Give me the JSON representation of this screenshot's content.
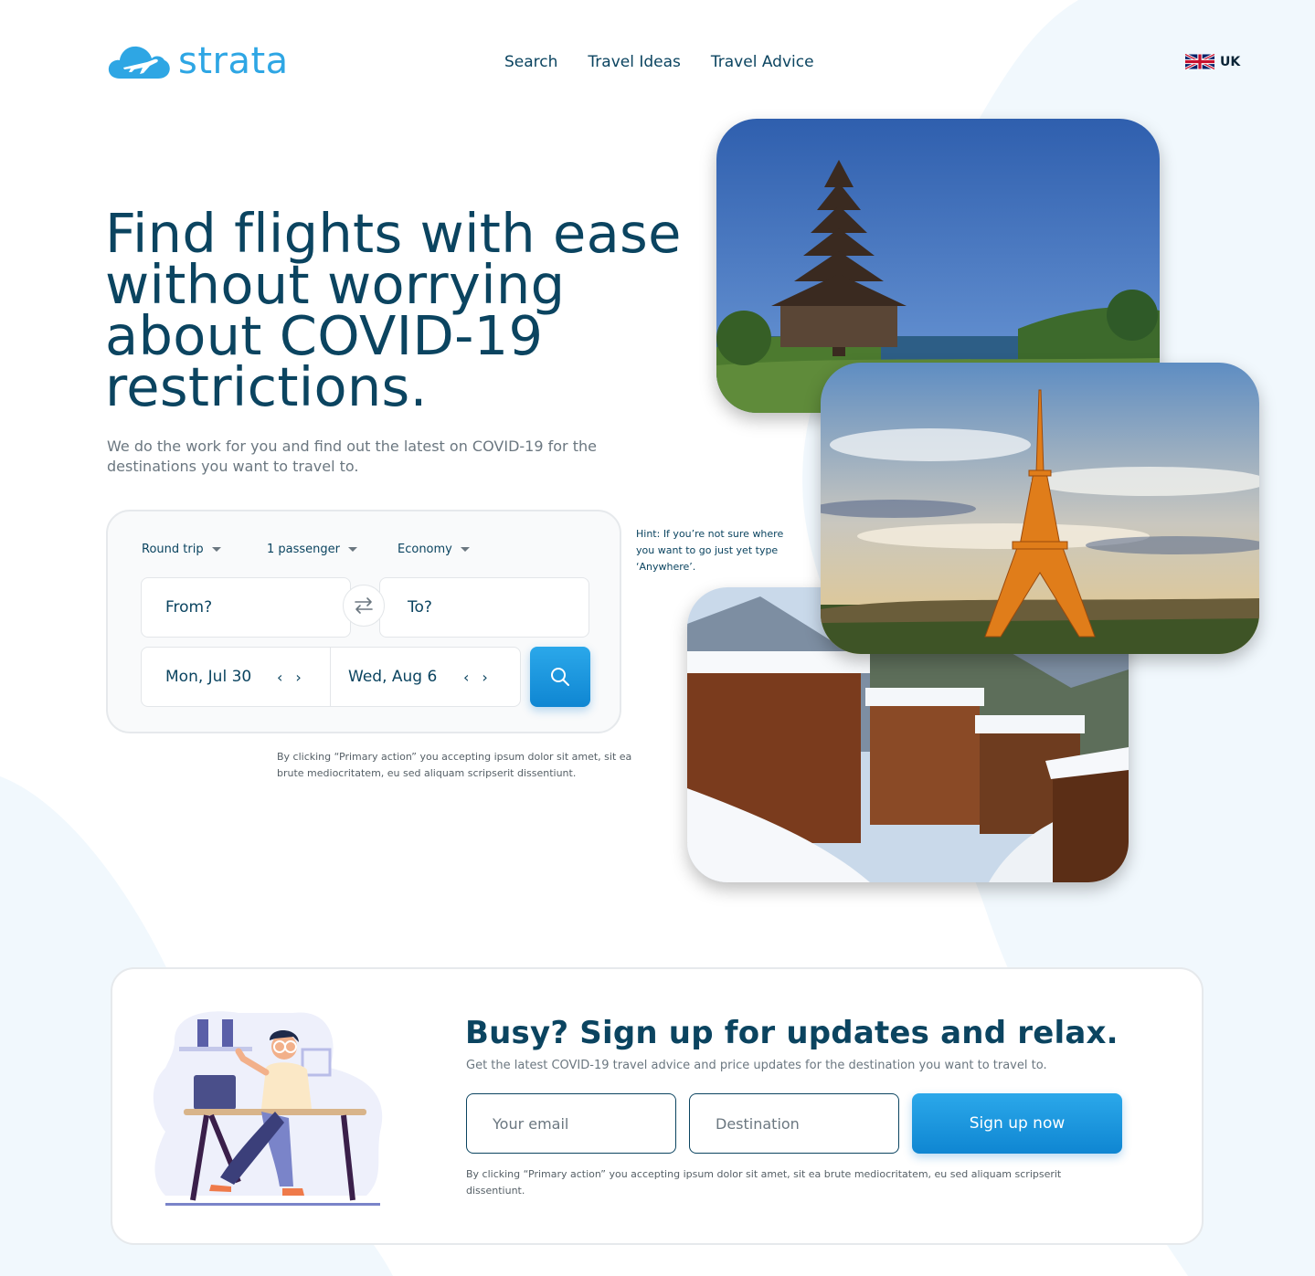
{
  "brand": {
    "name": "strata",
    "color": "#2ea6e4"
  },
  "nav": {
    "items": [
      "Search",
      "Travel Ideas",
      "Travel Advice"
    ]
  },
  "locale": {
    "label": "UK",
    "flag": "uk-flag-icon"
  },
  "hero": {
    "title": "Find flights with ease without worrying about COVID-19 restrictions.",
    "subtitle": "We do the work for you and find out the latest on COVID-19 for the destinations you want to travel to."
  },
  "search": {
    "trip_type": "Round trip",
    "passengers": "1 passenger",
    "cabin": "Economy",
    "from_placeholder": "From?",
    "to_placeholder": "To?",
    "depart_date": "Mon, Jul 30",
    "return_date": "Wed, Aug 6",
    "hint": "Hint: If you’re not sure where you want to go just yet type ‘Anywhere’.",
    "legal": "By clicking “Primary action” you accepting ipsum dolor sit amet, sit ea brute mediocritatem, eu sed aliquam scripserit dissentiunt."
  },
  "photos": [
    "bali-temple-photo",
    "eiffel-tower-photo",
    "snowy-village-photo"
  ],
  "signup": {
    "title": "Busy? Sign up for updates and relax.",
    "subtitle": "Get the latest COVID-19 travel advice and price updates for the destination you want to travel to.",
    "email_placeholder": "Your email",
    "destination_placeholder": "Destination",
    "button": "Sign up now",
    "legal": "By clicking “Primary action” you accepting ipsum dolor sit amet, sit ea brute mediocritatem, eu sed aliquam scripserit dissentiunt."
  },
  "colors": {
    "primary": "#0b4460",
    "accent": "#1496dd",
    "muted": "#6b7780"
  }
}
